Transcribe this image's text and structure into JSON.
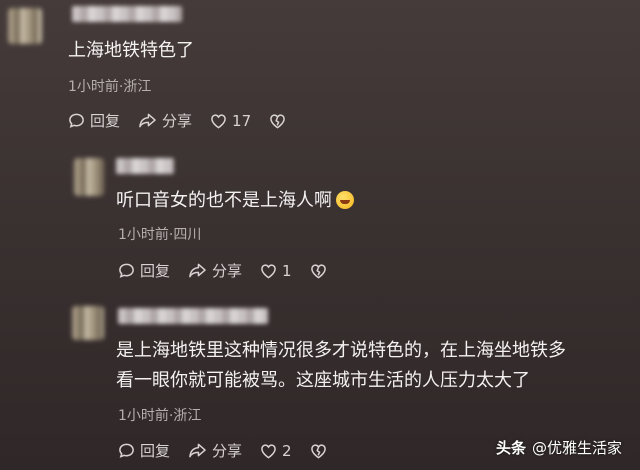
{
  "comments": [
    {
      "text": "上海地铁特色了",
      "meta": "1小时前·浙江",
      "reply_label": "回复",
      "share_label": "分享",
      "like_count": "17"
    },
    {
      "text": "听口音女的也不是上海人啊",
      "meta": "1小时前·四川",
      "reply_label": "回复",
      "share_label": "分享",
      "like_count": "1"
    },
    {
      "text_line1": "是上海地铁里这种情况很多才说特色的，在上海坐地铁多",
      "text_line2": "看一眼你就可能被骂。这座城市生活的人压力太大了",
      "meta": "1小时前·浙江",
      "reply_label": "回复",
      "share_label": "分享",
      "like_count": "2"
    }
  ],
  "watermark": {
    "brand": "头条",
    "author": "@优雅生活家"
  },
  "icons": [
    "reply-icon",
    "share-icon",
    "like-icon",
    "dislike-icon"
  ]
}
